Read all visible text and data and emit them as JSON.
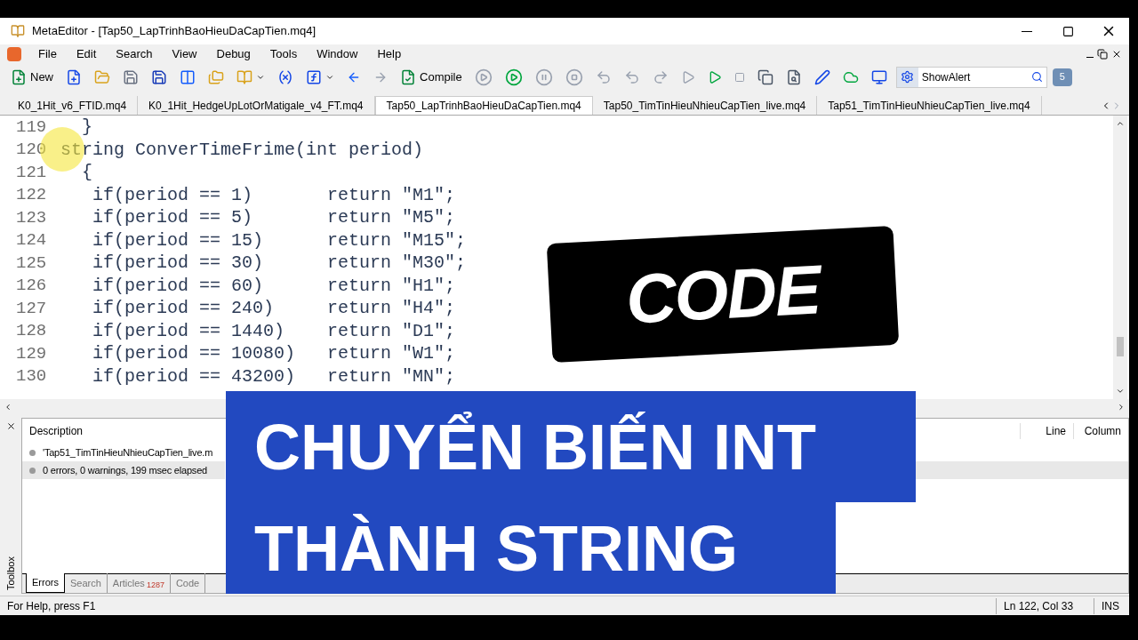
{
  "window": {
    "title": "MetaEditor - [Tap50_LapTrinhBaoHieuDaCapTien.mq4]"
  },
  "menu": [
    "File",
    "Edit",
    "Search",
    "View",
    "Debug",
    "Tools",
    "Window",
    "Help"
  ],
  "toolbar": {
    "new_label": "New",
    "compile_label": "Compile",
    "search_value": "ShowAlert",
    "notifications": "5"
  },
  "tabs": [
    {
      "label": "K0_1Hit_v6_FTID.mq4",
      "selected": false
    },
    {
      "label": "K0_1Hit_HedgeUpLotOrMatigale_v4_FT.mq4",
      "selected": false
    },
    {
      "label": "Tap50_LapTrinhBaoHieuDaCapTien.mq4",
      "selected": true
    },
    {
      "label": "Tap50_TimTinHieuNhieuCapTien_live.mq4",
      "selected": false
    },
    {
      "label": "Tap51_TimTinHieuNhieuCapTien_live.mq4",
      "selected": false
    }
  ],
  "code": [
    {
      "number": "119",
      "text": "  }"
    },
    {
      "number": "120",
      "text": "string ConverTimeFrime(int period)"
    },
    {
      "number": "121",
      "text": "  {"
    },
    {
      "number": "122",
      "text": "   if(period == 1)       return \"M1\";"
    },
    {
      "number": "123",
      "text": "   if(period == 5)       return \"M5\";"
    },
    {
      "number": "124",
      "text": "   if(period == 15)      return \"M15\";"
    },
    {
      "number": "125",
      "text": "   if(period == 30)      return \"M30\";"
    },
    {
      "number": "126",
      "text": "   if(period == 60)      return \"H1\";"
    },
    {
      "number": "127",
      "text": "   if(period == 240)     return \"H4\";"
    },
    {
      "number": "128",
      "text": "   if(period == 1440)    return \"D1\";"
    },
    {
      "number": "129",
      "text": "   if(period == 10080)   return \"W1\";"
    },
    {
      "number": "130",
      "text": "   if(period == 43200)   return \"MN\";"
    }
  ],
  "toolbox": {
    "title": "Toolbox",
    "columns": [
      "Description",
      "Line",
      "Column"
    ],
    "rows": [
      {
        "text": "'Tap51_TimTinHieuNhieuCapTien_live.m",
        "selected": false
      },
      {
        "text": "0 errors, 0 warnings, 199 msec elapsed",
        "selected": true
      }
    ],
    "tabs": [
      {
        "label": "Errors",
        "selected": true
      },
      {
        "label": "Search",
        "selected": false
      },
      {
        "label": "Articles",
        "badge": "1287",
        "selected": false
      },
      {
        "label": "Code",
        "selected": false
      }
    ]
  },
  "status_bar": {
    "help": "For Help, press F1",
    "position": "Ln 122, Col 33",
    "mode": "INS"
  },
  "overlay": {
    "badge": "CODE",
    "headline": [
      "CHUYỂN BIẾN INT",
      "THÀNH STRING"
    ]
  }
}
